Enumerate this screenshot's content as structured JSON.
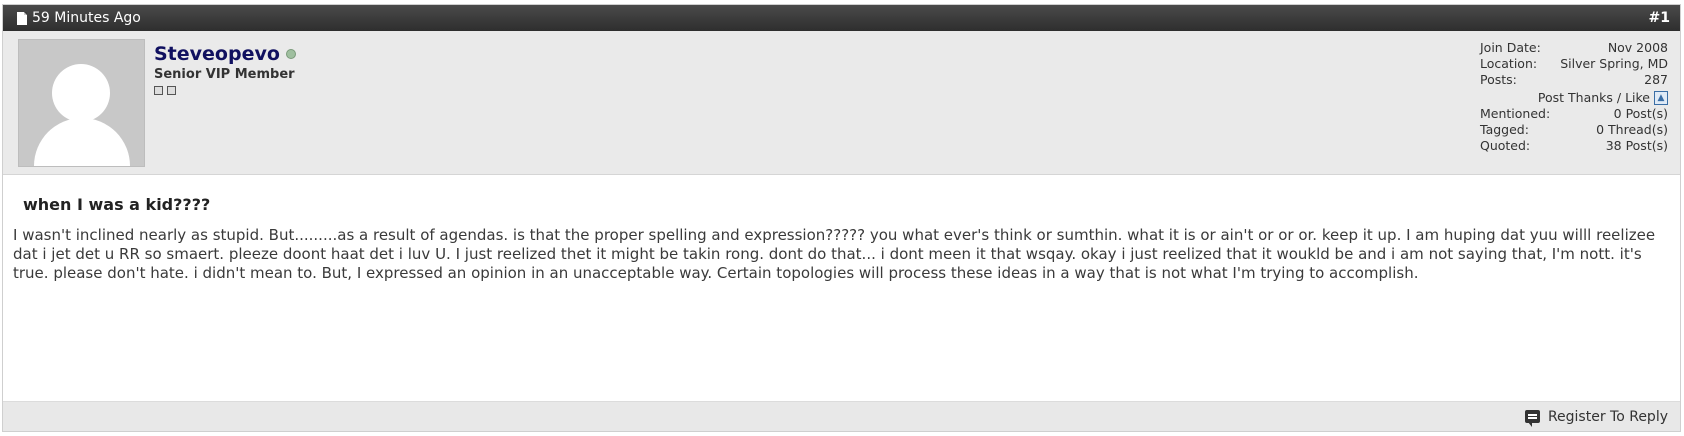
{
  "header": {
    "time": "59 Minutes Ago",
    "post_number": "#1"
  },
  "user": {
    "name": "Steveopevo",
    "title": "Senior VIP Member"
  },
  "stats": {
    "join_label": "Join Date:",
    "join_value": "Nov 2008",
    "location_label": "Location:",
    "location_value": "Silver Spring, MD",
    "posts_label": "Posts:",
    "posts_value": "287",
    "thanks_label": "Post Thanks / Like",
    "mentioned_label": "Mentioned:",
    "mentioned_value": "0 Post(s)",
    "tagged_label": "Tagged:",
    "tagged_value": "0 Thread(s)",
    "quoted_label": "Quoted:",
    "quoted_value": "38 Post(s)"
  },
  "post": {
    "title": "when I was a kid????",
    "body": "I wasn't inclined nearly as stupid. But.........as a result of agendas. is that the proper spelling and expression????? you what ever's think or sumthin. what it is or ain't or or or. keep it up. I am huping dat yuu willl reelizee dat i jet det u RR so smaert. pleeze doont haat det i luv U. I just reelized thet it might be takin rong. dont do that... i dont meen it that wsqay. okay i just reelized that it woukld be and i am not saying that, I'm nott. it's true. please don't hate. i didn't mean to. But, I expressed an opinion in an unacceptable way. Certain topologies will process these ideas in a way that is not what I'm trying to accomplish."
  },
  "footer": {
    "reply_label": "Register To Reply"
  }
}
